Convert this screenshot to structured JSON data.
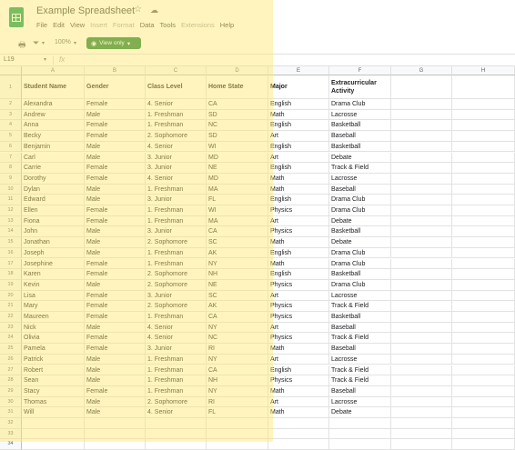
{
  "app": {
    "title": "Example Spreadsheet",
    "menus": [
      "File",
      "Edit",
      "View",
      "Insert",
      "Format",
      "Data",
      "Tools",
      "Extensions",
      "Help"
    ],
    "disabled_menus": [
      "Insert",
      "Format",
      "Extensions"
    ]
  },
  "toolbar": {
    "zoom": "100%",
    "view_only_label": "View only"
  },
  "formula_bar": {
    "name_box": "L19",
    "fx": "fx"
  },
  "colors": {
    "brand": "#0f9d58",
    "view_only": "#188038",
    "highlight": "#ffe66e"
  },
  "sheet": {
    "column_letters": [
      "A",
      "B",
      "C",
      "D",
      "E",
      "F",
      "G",
      "H"
    ],
    "headers": [
      "Student Name",
      "Gender",
      "Class Level",
      "Home State",
      "Major",
      "Extracurricular Activity"
    ],
    "rows": [
      [
        "Alexandra",
        "Female",
        "4. Senior",
        "CA",
        "English",
        "Drama Club"
      ],
      [
        "Andrew",
        "Male",
        "1. Freshman",
        "SD",
        "Math",
        "Lacrosse"
      ],
      [
        "Anna",
        "Female",
        "1. Freshman",
        "NC",
        "English",
        "Basketball"
      ],
      [
        "Becky",
        "Female",
        "2. Sophomore",
        "SD",
        "Art",
        "Baseball"
      ],
      [
        "Benjamin",
        "Male",
        "4. Senior",
        "WI",
        "English",
        "Basketball"
      ],
      [
        "Carl",
        "Male",
        "3. Junior",
        "MD",
        "Art",
        "Debate"
      ],
      [
        "Carrie",
        "Female",
        "3. Junior",
        "NE",
        "English",
        "Track & Field"
      ],
      [
        "Dorothy",
        "Female",
        "4. Senior",
        "MD",
        "Math",
        "Lacrosse"
      ],
      [
        "Dylan",
        "Male",
        "1. Freshman",
        "MA",
        "Math",
        "Baseball"
      ],
      [
        "Edward",
        "Male",
        "3. Junior",
        "FL",
        "English",
        "Drama Club"
      ],
      [
        "Ellen",
        "Female",
        "1. Freshman",
        "WI",
        "Physics",
        "Drama Club"
      ],
      [
        "Fiona",
        "Female",
        "1. Freshman",
        "MA",
        "Art",
        "Debate"
      ],
      [
        "John",
        "Male",
        "3. Junior",
        "CA",
        "Physics",
        "Basketball"
      ],
      [
        "Jonathan",
        "Male",
        "2. Sophomore",
        "SC",
        "Math",
        "Debate"
      ],
      [
        "Joseph",
        "Male",
        "1. Freshman",
        "AK",
        "English",
        "Drama Club"
      ],
      [
        "Josephine",
        "Female",
        "1. Freshman",
        "NY",
        "Math",
        "Drama Club"
      ],
      [
        "Karen",
        "Female",
        "2. Sophomore",
        "NH",
        "English",
        "Basketball"
      ],
      [
        "Kevin",
        "Male",
        "2. Sophomore",
        "NE",
        "Physics",
        "Drama Club"
      ],
      [
        "Lisa",
        "Female",
        "3. Junior",
        "SC",
        "Art",
        "Lacrosse"
      ],
      [
        "Mary",
        "Female",
        "2. Sophomore",
        "AK",
        "Physics",
        "Track & Field"
      ],
      [
        "Maureen",
        "Female",
        "1. Freshman",
        "CA",
        "Physics",
        "Basketball"
      ],
      [
        "Nick",
        "Male",
        "4. Senior",
        "NY",
        "Art",
        "Baseball"
      ],
      [
        "Olivia",
        "Female",
        "4. Senior",
        "NC",
        "Physics",
        "Track & Field"
      ],
      [
        "Pamela",
        "Female",
        "3. Junior",
        "RI",
        "Math",
        "Baseball"
      ],
      [
        "Patrick",
        "Male",
        "1. Freshman",
        "NY",
        "Art",
        "Lacrosse"
      ],
      [
        "Robert",
        "Male",
        "1. Freshman",
        "CA",
        "English",
        "Track & Field"
      ],
      [
        "Sean",
        "Male",
        "1. Freshman",
        "NH",
        "Physics",
        "Track & Field"
      ],
      [
        "Stacy",
        "Female",
        "1. Freshman",
        "NY",
        "Math",
        "Baseball"
      ],
      [
        "Thomas",
        "Male",
        "2. Sophomore",
        "RI",
        "Art",
        "Lacrosse"
      ],
      [
        "Will",
        "Male",
        "4. Senior",
        "FL",
        "Math",
        "Debate"
      ]
    ],
    "total_rows": 34
  }
}
